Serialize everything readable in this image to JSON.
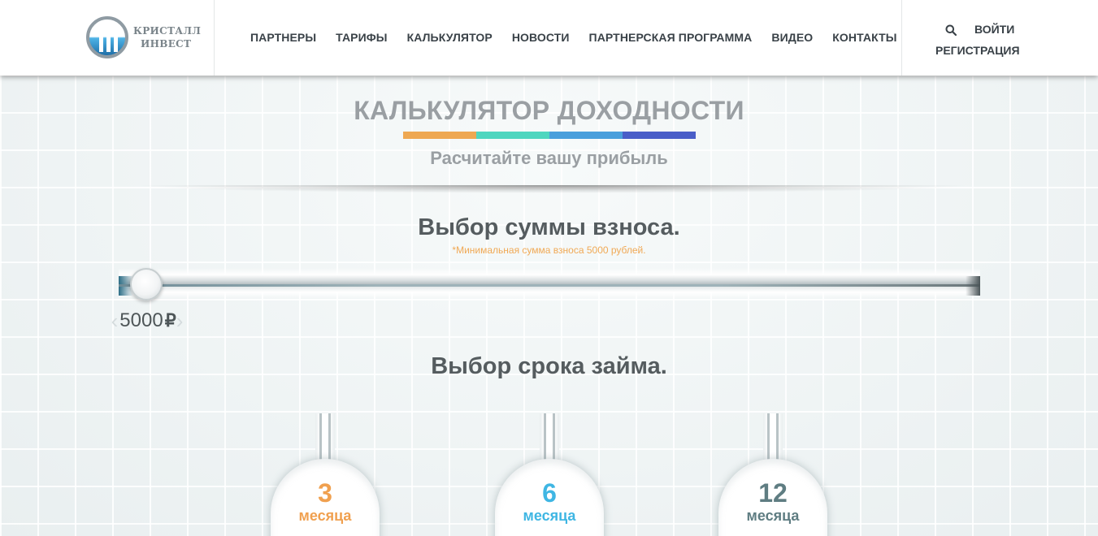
{
  "logo": {
    "line1": "КРИСТАЛЛ",
    "line2": "ИНВЕСТ"
  },
  "nav": {
    "items": [
      "ПАРТНЕРЫ",
      "ТАРИФЫ",
      "КАЛЬКУЛЯТОР",
      "НОВОСТИ",
      "ПАРТНЕРСКАЯ ПРОГРАММА",
      "ВИДЕО",
      "КОНТАКТЫ"
    ]
  },
  "auth": {
    "login": "ВОЙТИ",
    "register": "РЕГИСТРАЦИЯ"
  },
  "hero": {
    "title": "КАЛЬКУЛЯТОР ДОХОДНОСТИ",
    "subtitle": "Расчитайте вашу прибыль",
    "bar_colors": [
      "#eea852",
      "#4fd6bf",
      "#4a9fdc",
      "#4a5ec8"
    ]
  },
  "amount": {
    "title": "Выбор суммы взноса.",
    "note": "*Минимальная сумма взноса 5000 рублей.",
    "value": "5000",
    "currency": "₽",
    "slider_fraction": 0
  },
  "term": {
    "title": "Выбор срока займа.",
    "options": [
      {
        "number": "3",
        "label": "месяца",
        "color": "#f0a04f"
      },
      {
        "number": "6",
        "label": "месяца",
        "color": "#3fb6e3"
      },
      {
        "number": "12",
        "label": "месяца",
        "color": "#5f7d82"
      }
    ]
  }
}
